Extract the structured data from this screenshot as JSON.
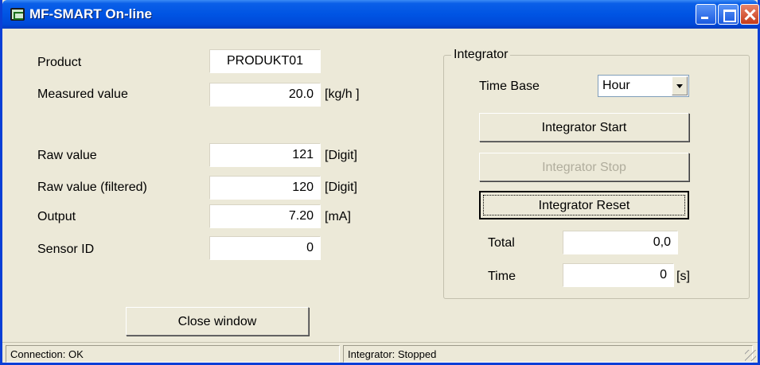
{
  "window": {
    "title": "MF-SMART On-line",
    "title_color": "#0054e3"
  },
  "form": {
    "product": {
      "label": "Product",
      "value": "PRODUKT01"
    },
    "measured": {
      "label": "Measured value",
      "value": "20.0",
      "unit": "[kg/h ]"
    },
    "raw": {
      "label": "Raw value",
      "value": "121",
      "unit": "[Digit]"
    },
    "raw_filtered": {
      "label": "Raw value (filtered)",
      "value": "120",
      "unit": "[Digit]"
    },
    "output": {
      "label": "Output",
      "value": "7.20",
      "unit": "[mA]"
    },
    "sensor_id": {
      "label": "Sensor ID",
      "value": "0"
    },
    "close_button": "Close window"
  },
  "integrator": {
    "group_title": "Integrator",
    "time_base_label": "Time Base",
    "time_base_value": "Hour",
    "start_button": "Integrator Start",
    "stop_button": "Integrator Stop",
    "reset_button": "Integrator Reset",
    "total_label": "Total",
    "total_value": "0,0",
    "time_label": "Time",
    "time_value": "0",
    "time_unit": "[s]"
  },
  "status": {
    "connection": "Connection: OK",
    "integrator": "Integrator: Stopped"
  },
  "icons": [
    "app-icon",
    "minimize-icon",
    "maximize-icon",
    "close-icon",
    "dropdown-arrow-icon",
    "size-grip-icon"
  ]
}
